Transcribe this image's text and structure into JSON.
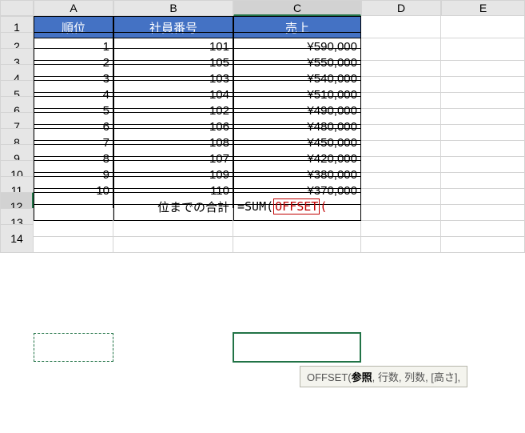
{
  "columns": [
    "A",
    "B",
    "C",
    "D",
    "E"
  ],
  "rows": [
    "1",
    "2",
    "3",
    "4",
    "5",
    "6",
    "7",
    "8",
    "9",
    "10",
    "11",
    "12",
    "13",
    "14"
  ],
  "header": {
    "rank": "順位",
    "empno": "社員番号",
    "sales": "売上"
  },
  "data": [
    {
      "rank": "1",
      "empno": "101",
      "sales": "¥590,000"
    },
    {
      "rank": "2",
      "empno": "105",
      "sales": "¥550,000"
    },
    {
      "rank": "3",
      "empno": "103",
      "sales": "¥540,000"
    },
    {
      "rank": "4",
      "empno": "104",
      "sales": "¥510,000"
    },
    {
      "rank": "5",
      "empno": "102",
      "sales": "¥490,000"
    },
    {
      "rank": "6",
      "empno": "106",
      "sales": "¥480,000"
    },
    {
      "rank": "7",
      "empno": "108",
      "sales": "¥450,000"
    },
    {
      "rank": "8",
      "empno": "107",
      "sales": "¥420,000"
    },
    {
      "rank": "9",
      "empno": "109",
      "sales": "¥380,000"
    },
    {
      "rank": "10",
      "empno": "110",
      "sales": "¥370,000"
    }
  ],
  "sum_label": "位までの合計",
  "formula": {
    "prefix": "=SUM(",
    "fn": "OFFSET",
    "paren": "("
  },
  "tooltip": {
    "fn": "OFFSET(",
    "arg1": "参照",
    "rest": ", 行数, 列数, [高さ],"
  },
  "chart_data": {
    "type": "table",
    "title": "売上",
    "columns": [
      "順位",
      "社員番号",
      "売上"
    ],
    "rows": [
      [
        1,
        101,
        590000
      ],
      [
        2,
        105,
        550000
      ],
      [
        3,
        103,
        540000
      ],
      [
        4,
        104,
        510000
      ],
      [
        5,
        102,
        490000
      ],
      [
        6,
        106,
        480000
      ],
      [
        7,
        108,
        450000
      ],
      [
        8,
        107,
        420000
      ],
      [
        9,
        109,
        380000
      ],
      [
        10,
        110,
        370000
      ]
    ]
  }
}
